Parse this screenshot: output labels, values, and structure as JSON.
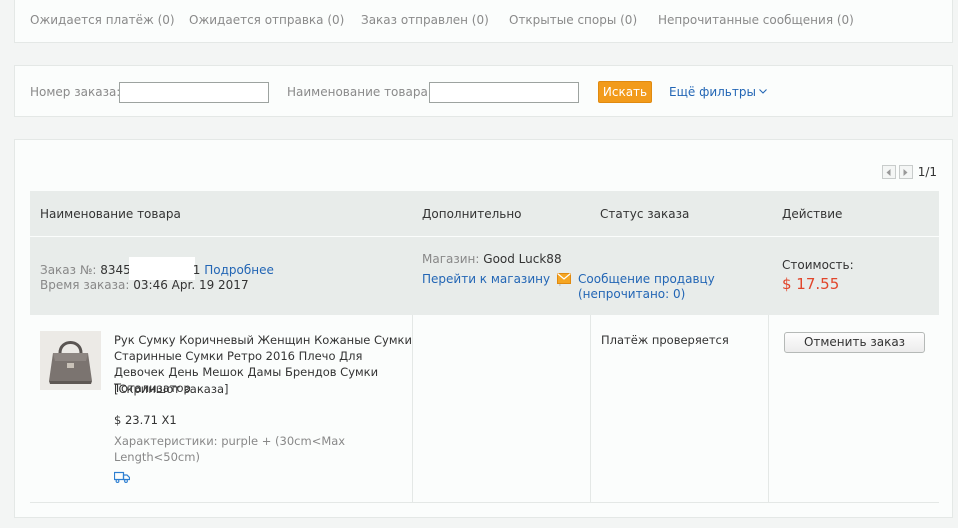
{
  "status_tabs": [
    "Ожидается платёж (0)",
    "Ожидается отправка (0)",
    "Заказ отправлен (0)",
    "Открытые споры (0)",
    "Непрочитанные сообщения (0)"
  ],
  "filters": {
    "order_number_label": "Номер заказа:",
    "order_number_value": "",
    "product_name_label": "Наименование товара:",
    "product_name_value": "",
    "search_button": "Искать",
    "more_filters": "Ещё фильтры"
  },
  "pagination": {
    "page": "1/1"
  },
  "table_headers": {
    "product": "Наименование товара",
    "additional": "Дополнительно",
    "status": "Статус заказа",
    "action": "Действие"
  },
  "order": {
    "number_label": "Заказ №:",
    "number_prefix": "8345",
    "number_suffix": "1",
    "details_link": "Подробнее",
    "time_label": "Время заказа:",
    "time_value": "03:46 Apr. 19 2017",
    "store_label": "Магазин:",
    "store_name": "Good Luck88",
    "goto_store": "Перейти к магазину",
    "separator": "|",
    "message_seller": "Сообщение продавцу",
    "unread_prefix": "(непрочитано: ",
    "unread_count": "0",
    "unread_suffix": ")",
    "cost_label": "Стоимость:",
    "cost_value": "$ 17.55",
    "price_color": "#e1462b"
  },
  "item": {
    "title": "Рук Сумку Коричневый Женщин Кожаные Сумки Старинные Сумки Ретро 2016 Плечо Для Девочек День Мешок Дамы Брендов Сумки Тотализатор",
    "snapshot_link": "[Скриншот заказа]",
    "price_qty": "$ 23.71 X1",
    "spec_label": "Характеристики:",
    "spec_value": "purple + (30cm<Max Length<50cm)",
    "shipping_icon": "truck-icon",
    "status": "Платёж проверяется",
    "cancel_button": "Отменить заказ"
  },
  "colors": {
    "accent_orange": "#f29b1b",
    "link_blue": "#2366b5",
    "header_bg": "#e8ecea"
  }
}
